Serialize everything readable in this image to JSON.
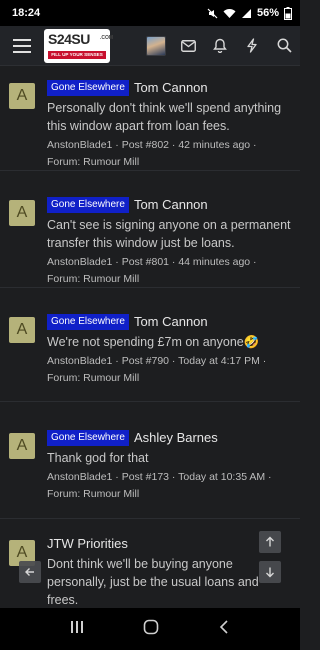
{
  "status": {
    "time": "18:24",
    "battery": "56%"
  },
  "header": {
    "logo_text": "S24SU",
    "logo_dotcom": ".COM",
    "logo_tagline": "FILL UP YOUR SENSES"
  },
  "items": [
    {
      "avatar": "A",
      "badge": "Gone Elsewhere",
      "title": "Tom Cannon",
      "snippet": "Personally don't think we'll spend anything this window apart from loan fees.",
      "meta": "AnstonBlade1 · Post #802 · 42 minutes ago · Forum: Rumour Mill"
    },
    {
      "avatar": "A",
      "badge": "Gone Elsewhere",
      "title": "Tom Cannon",
      "snippet": "Can't see is signing anyone on a permanent transfer this window just be loans.",
      "meta": "AnstonBlade1 · Post #801 · 44 minutes ago · Forum: Rumour Mill"
    },
    {
      "avatar": "A",
      "badge": "Gone Elsewhere",
      "title": "Tom Cannon",
      "snippet": "We're not spending £7m on anyone🤣",
      "meta": "AnstonBlade1 · Post #790 · Today at 4:17 PM · Forum: Rumour Mill"
    },
    {
      "avatar": "A",
      "badge": "Gone Elsewhere",
      "title": "Ashley Barnes",
      "snippet": "Thank god for that",
      "meta": "AnstonBlade1 · Post #173 · Today at 10:35 AM · Forum: Rumour Mill"
    },
    {
      "avatar": "A",
      "badge": "",
      "title": "JTW Priorities",
      "snippet": "Dont think we'll be buying anyone personally, just be the usual loans and frees.",
      "meta": ""
    }
  ],
  "icons": {
    "menu": "hamburger-menu-icon",
    "inbox": "inbox-icon",
    "alerts": "bell-icon",
    "whats_new": "lightning-icon",
    "search": "search-icon",
    "back": "arrow-left-icon",
    "scroll_up": "arrow-up-icon",
    "scroll_down": "arrow-down-icon"
  },
  "colors": {
    "badge": "#1020c8",
    "avatar_bg": "#b5b27a",
    "background": "#1d1e20",
    "header": "#222428"
  }
}
